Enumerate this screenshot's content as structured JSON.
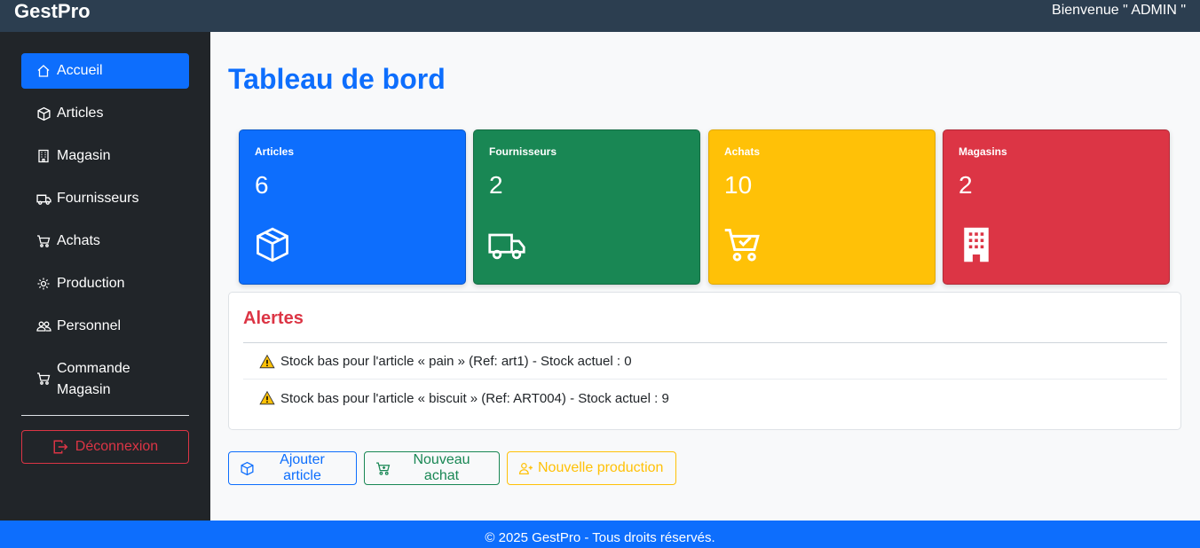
{
  "header": {
    "brand": "GestPro",
    "welcome": "Bienvenue \" ADMIN \""
  },
  "sidebar": {
    "items": [
      {
        "label": "Accueil",
        "icon": "home-icon",
        "active": true
      },
      {
        "label": "Articles",
        "icon": "box-icon"
      },
      {
        "label": "Magasin",
        "icon": "building-icon"
      },
      {
        "label": "Fournisseurs",
        "icon": "truck-icon"
      },
      {
        "label": "Achats",
        "icon": "cart-icon"
      },
      {
        "label": "Production",
        "icon": "gear-icon"
      },
      {
        "label": "Personnel",
        "icon": "people-icon"
      },
      {
        "label": "Commande Magasin",
        "icon": "cart-icon"
      }
    ],
    "logout": "Déconnexion"
  },
  "main": {
    "title": "Tableau de bord",
    "cards": [
      {
        "title": "Articles",
        "value": "6",
        "icon": "box-icon",
        "color": "#0d6efd"
      },
      {
        "title": "Fournisseurs",
        "value": "2",
        "icon": "truck-icon",
        "color": "#198754"
      },
      {
        "title": "Achats",
        "value": "10",
        "icon": "cart-check-icon",
        "color": "#ffc107"
      },
      {
        "title": "Magasins",
        "value": "2",
        "icon": "building-icon",
        "color": "#dc3545"
      }
    ],
    "alerts": {
      "title": "Alertes",
      "items": [
        "Stock bas pour l'article « pain » (Ref: art1) - Stock actuel : 0",
        "Stock bas pour l'article « biscuit » (Ref: ART004) - Stock actuel : 9"
      ]
    },
    "actions": [
      {
        "label": "Ajouter article",
        "icon": "box-icon"
      },
      {
        "label": "Nouveau achat",
        "icon": "cart-plus-icon"
      },
      {
        "label": "Nouvelle production",
        "icon": "person-plus-icon"
      }
    ]
  },
  "footer": {
    "text": "© 2025 GestPro - Tous droits réservés."
  }
}
